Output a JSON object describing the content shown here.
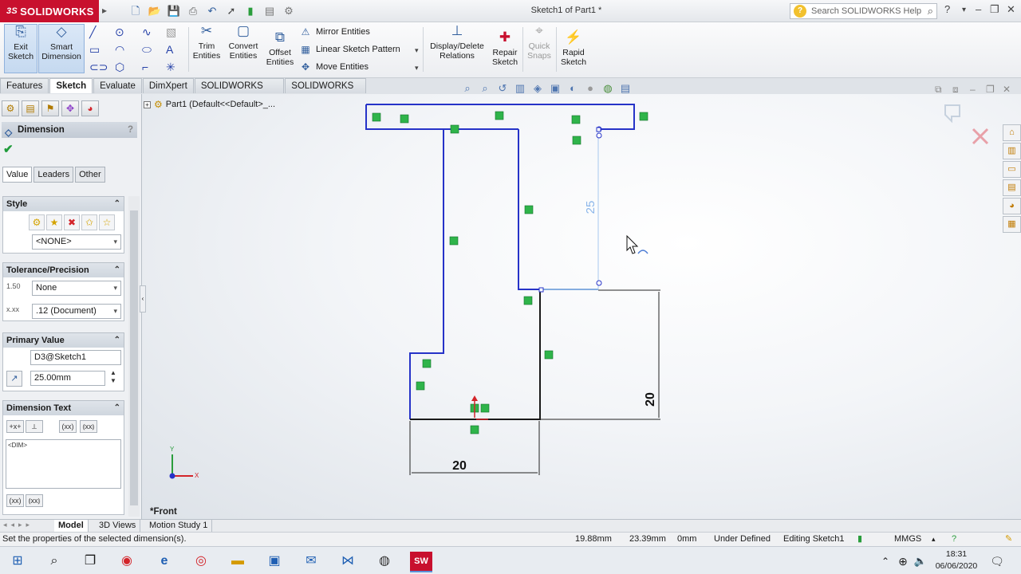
{
  "app": {
    "brand_prefix": "3S",
    "brand": "SOLIDWORKS",
    "doc_title": "Sketch1 of Part1 *"
  },
  "search": {
    "placeholder": "Search SOLIDWORKS Help"
  },
  "commands": {
    "exit_sketch": "Exit Sketch",
    "smart_dimension": "Smart Dimension",
    "trim_entities": "Trim Entities",
    "convert_entities": "Convert Entities",
    "offset_entities": "Offset Entities",
    "mirror_entities": "Mirror Entities",
    "linear_sketch_pattern": "Linear Sketch Pattern",
    "move_entities": "Move Entities",
    "display_delete_relations": "Display/Delete Relations",
    "repair_sketch": "Repair Sketch",
    "quick_snaps": "Quick Snaps",
    "rapid_sketch": "Rapid Sketch"
  },
  "tabs": [
    {
      "label": "Features"
    },
    {
      "label": "Sketch"
    },
    {
      "label": "Evaluate"
    },
    {
      "label": "DimXpert"
    },
    {
      "label": "SOLIDWORKS Add-Ins"
    },
    {
      "label": "SOLIDWORKS MBD"
    }
  ],
  "property_manager": {
    "title": "Dimension",
    "help": "?",
    "subtabs": [
      {
        "label": "Value"
      },
      {
        "label": "Leaders"
      },
      {
        "label": "Other"
      }
    ],
    "style": {
      "title": "Style",
      "selected": "<NONE>"
    },
    "tolerance": {
      "title": "Tolerance/Precision",
      "tolerance_type": "None",
      "precision": ".12 (Document)"
    },
    "primary_value": {
      "title": "Primary Value",
      "name": "D3@Sketch1",
      "value": "25.00mm"
    },
    "dimension_text": {
      "title": "Dimension Text",
      "text": "<DIM>"
    }
  },
  "tree": {
    "root": "Part1  (Default<<Default>_..."
  },
  "sketch": {
    "dim_vertical_25": "25",
    "dim_vertical_20": "20",
    "dim_horizontal_20": "20",
    "view_label": "*Front",
    "axis_x": "X",
    "axis_y": "Y"
  },
  "bottom_tabs": [
    {
      "label": "Model"
    },
    {
      "label": "3D Views"
    },
    {
      "label": "Motion Study 1"
    }
  ],
  "status": {
    "message": "Set the properties of the selected dimension(s).",
    "x": "19.88mm",
    "y": "23.39mm",
    "z": "0mm",
    "state": "Under Defined",
    "editing": "Editing Sketch1",
    "units": "MMGS"
  },
  "clock": {
    "time": "18:31",
    "date": "06/06/2020"
  }
}
